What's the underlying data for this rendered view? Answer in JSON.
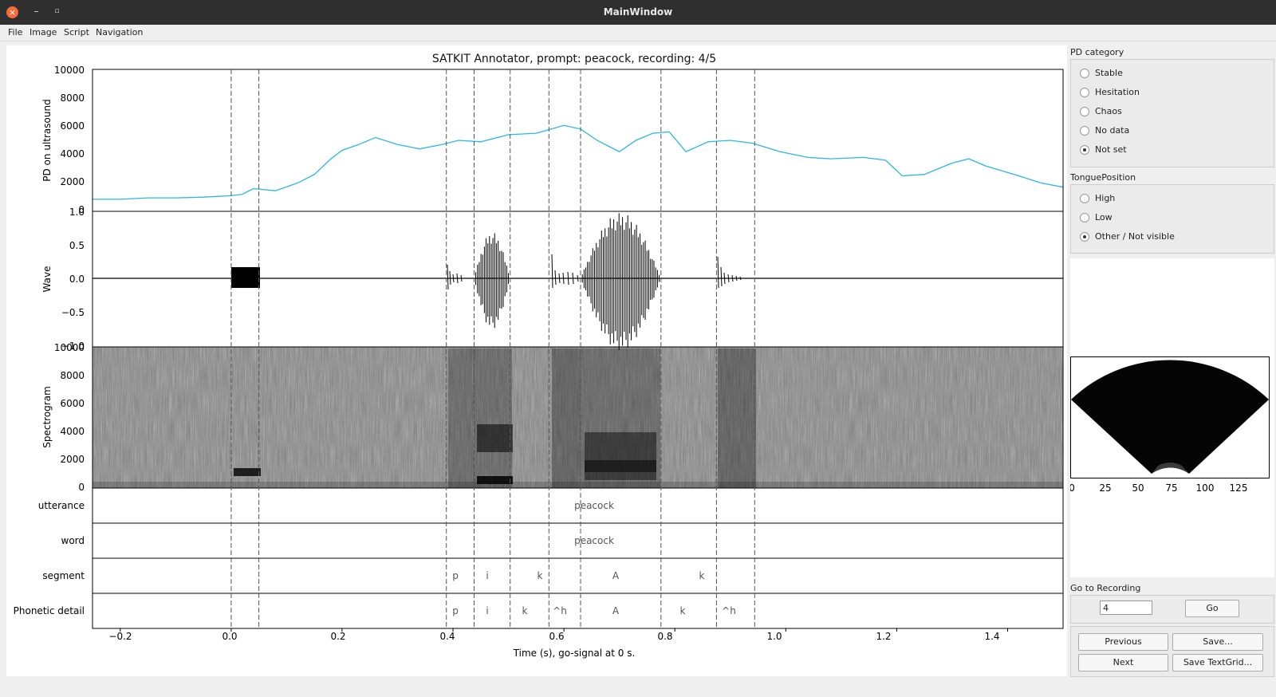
{
  "window": {
    "title": "MainWindow",
    "close_glyph": "×",
    "min_glyph": "–",
    "max_glyph": "▫"
  },
  "menu": [
    "File",
    "Image",
    "Script",
    "Navigation"
  ],
  "plot": {
    "title": "SATKIT Annotator, prompt: peacock, recording: 4/5",
    "xlabel": "Time (s), go-signal at 0 s.",
    "x_ticks": [
      "−0.2",
      "0.0",
      "0.2",
      "0.4",
      "0.6",
      "0.8",
      "1.0",
      "1.2",
      "1.4"
    ],
    "pd_ylabel": "PD on ultrasound",
    "pd_ticks": [
      "10000",
      "8000",
      "6000",
      "4000",
      "2000",
      "0"
    ],
    "wave_ylabel": "Wave",
    "wave_ticks": [
      "1.0",
      "0.5",
      "0.0",
      "−0.5",
      "−1.0"
    ],
    "spec_ylabel": "Spectrogram",
    "spec_ticks": [
      "10000",
      "8000",
      "6000",
      "4000",
      "2000",
      "0"
    ],
    "tier_utterance": "utterance",
    "tier_word": "word",
    "tier_segment": "segment",
    "tier_phonetic": "Phonetic detail",
    "utterance_text": "peacock",
    "word_text": "peacock",
    "segments": [
      "p",
      "i",
      "k",
      "A",
      "k"
    ],
    "phones": [
      "p",
      "i",
      "k",
      "^h",
      "A",
      "k",
      "^h"
    ],
    "boundaries_s": [
      0.0,
      0.05,
      0.388,
      0.438,
      0.503,
      0.573,
      0.63,
      0.775,
      0.875,
      0.944
    ],
    "pd_color": "#2ab7e8",
    "pd_series": [
      [
        -0.25,
        850
      ],
      [
        -0.2,
        850
      ],
      [
        -0.15,
        950
      ],
      [
        -0.1,
        950
      ],
      [
        -0.05,
        1000
      ],
      [
        0.0,
        1100
      ],
      [
        0.02,
        1200
      ],
      [
        0.04,
        1600
      ],
      [
        0.08,
        1450
      ],
      [
        0.12,
        2000
      ],
      [
        0.15,
        2600
      ],
      [
        0.18,
        3700
      ],
      [
        0.2,
        4300
      ],
      [
        0.23,
        4700
      ],
      [
        0.26,
        5200
      ],
      [
        0.3,
        4700
      ],
      [
        0.34,
        4400
      ],
      [
        0.38,
        4700
      ],
      [
        0.41,
        5000
      ],
      [
        0.45,
        4900
      ],
      [
        0.5,
        5400
      ],
      [
        0.55,
        5500
      ],
      [
        0.6,
        6050
      ],
      [
        0.63,
        5800
      ],
      [
        0.66,
        5000
      ],
      [
        0.7,
        4200
      ],
      [
        0.73,
        5000
      ],
      [
        0.76,
        5500
      ],
      [
        0.79,
        5600
      ],
      [
        0.82,
        4200
      ],
      [
        0.86,
        4900
      ],
      [
        0.9,
        5000
      ],
      [
        0.94,
        4800
      ],
      [
        0.99,
        4200
      ],
      [
        1.04,
        3800
      ],
      [
        1.08,
        3700
      ],
      [
        1.14,
        3800
      ],
      [
        1.18,
        3600
      ],
      [
        1.21,
        2500
      ],
      [
        1.25,
        2600
      ],
      [
        1.3,
        3400
      ],
      [
        1.33,
        3700
      ],
      [
        1.36,
        3200
      ],
      [
        1.42,
        2500
      ],
      [
        1.46,
        2000
      ],
      [
        1.5,
        1700
      ]
    ]
  },
  "pd_category": {
    "label": "PD category",
    "options": [
      "Stable",
      "Hesitation",
      "Chaos",
      "No data",
      "Not set"
    ],
    "selected": "Not set"
  },
  "tongue_position": {
    "label": "TonguePosition",
    "options": [
      "High",
      "Low",
      "Other / Not visible"
    ],
    "selected": "Other / Not visible"
  },
  "ultrasound": {
    "x_ticks": [
      "0",
      "25",
      "50",
      "75",
      "100",
      "125"
    ]
  },
  "goto": {
    "label": "Go to Recording",
    "value": "4",
    "button": "Go"
  },
  "buttons": {
    "previous": "Previous",
    "next": "Next",
    "save": "Save...",
    "save_textgrid": "Save TextGrid..."
  }
}
